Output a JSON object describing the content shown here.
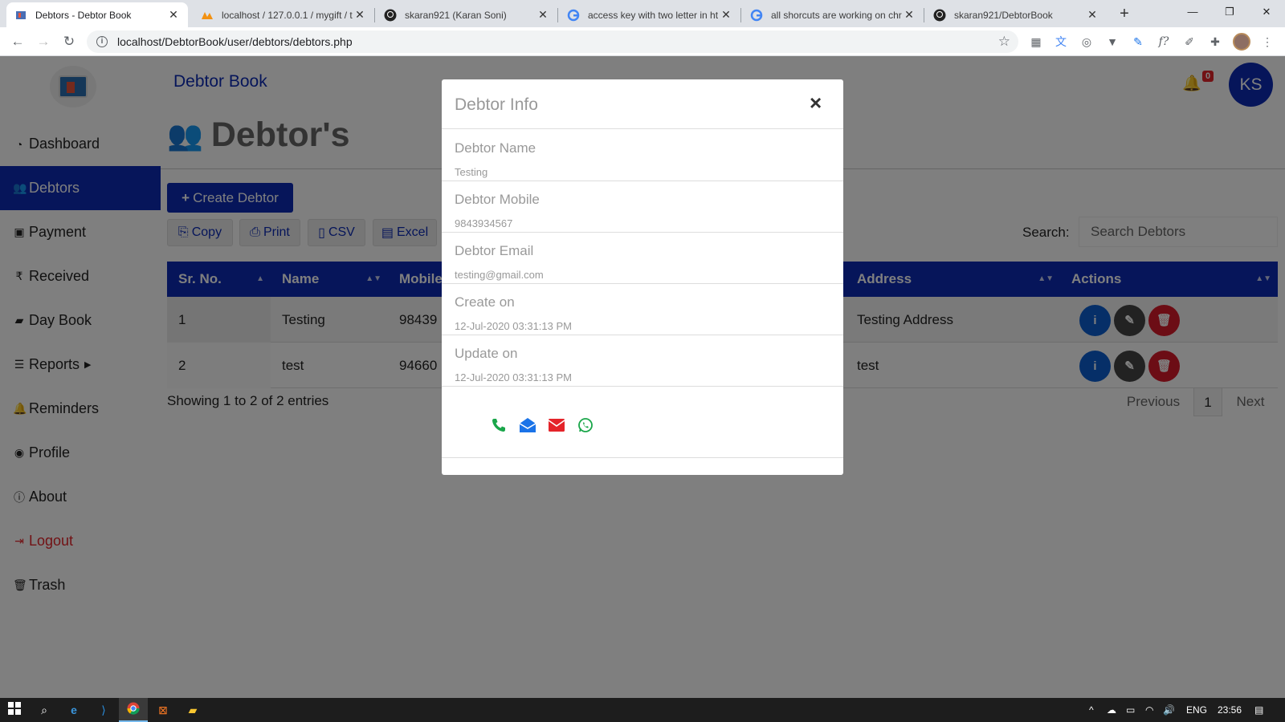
{
  "browser": {
    "tabs": [
      {
        "title": "Debtors - Debtor Book",
        "icon": "debtor-book-favicon",
        "active": true
      },
      {
        "title": "localhost / 127.0.0.1 / mygift / t",
        "icon": "phpmyadmin-favicon",
        "active": false
      },
      {
        "title": "skaran921 (Karan Soni)",
        "icon": "github-favicon",
        "active": false
      },
      {
        "title": "access key with two letter in ht",
        "icon": "google-favicon",
        "active": false
      },
      {
        "title": "all shorcuts are working on chr",
        "icon": "google-favicon",
        "active": false
      },
      {
        "title": "skaran921/DebtorBook",
        "icon": "github-favicon",
        "active": false
      }
    ],
    "url": "localhost/DebtorBook/user/debtors/debtors.php"
  },
  "app": {
    "brand": "Debtor Book",
    "notification_count": "0",
    "user_initials": "KS"
  },
  "sidebar": {
    "items": [
      {
        "label": "Dashboard",
        "icon": "dashboard-icon"
      },
      {
        "label": "Debtors",
        "icon": "users-icon",
        "active": true
      },
      {
        "label": "Payment",
        "icon": "money-icon"
      },
      {
        "label": "Received",
        "icon": "rupee-icon"
      },
      {
        "label": "Day Book",
        "icon": "book-icon"
      },
      {
        "label": "Reports",
        "icon": "list-icon"
      },
      {
        "label": "Reminders",
        "icon": "bell-icon"
      },
      {
        "label": "Profile",
        "icon": "user-circle-icon"
      },
      {
        "label": "About",
        "icon": "info-icon"
      },
      {
        "label": "Logout",
        "icon": "sign-out-icon"
      },
      {
        "label": "Trash",
        "icon": "trash-icon"
      }
    ]
  },
  "main": {
    "heading": "Debtor's",
    "create_button": "Create Debtor",
    "export_buttons": [
      "Copy",
      "Print",
      "CSV",
      "Excel"
    ],
    "search_label": "Search:",
    "search_placeholder": "Search Debtors",
    "columns": [
      "Sr. No.",
      "Name",
      "Mobile",
      "Address",
      "Actions"
    ],
    "rows": [
      {
        "sr": "1",
        "name": "Testing",
        "mobile": "98439",
        "address": "Testing Address"
      },
      {
        "sr": "2",
        "name": "test",
        "mobile": "94660",
        "address": "test"
      }
    ],
    "entries_info": "Showing 1 to 2 of 2 entries",
    "pagination": {
      "previous": "Previous",
      "page": "1",
      "next": "Next"
    }
  },
  "modal": {
    "title": "Debtor Info",
    "close": "×",
    "fields": [
      {
        "label": "Debtor Name",
        "value": "Testing"
      },
      {
        "label": "Debtor Mobile",
        "value": "9843934567"
      },
      {
        "label": "Debtor Email",
        "value": "testing@gmail.com"
      },
      {
        "label": "Create on",
        "value": "12-Jul-2020 03:31:13 PM"
      },
      {
        "label": "Update on",
        "value": "12-Jul-2020 03:31:13 PM"
      }
    ],
    "contact_icons": [
      "phone-icon",
      "envelope-open-icon",
      "envelope-icon",
      "whatsapp-icon"
    ]
  },
  "taskbar": {
    "language": "ENG",
    "time": "23:56"
  },
  "colors": {
    "primary": "#0c2bb5",
    "danger": "#d81a2a",
    "info": "#0c5fd0"
  }
}
